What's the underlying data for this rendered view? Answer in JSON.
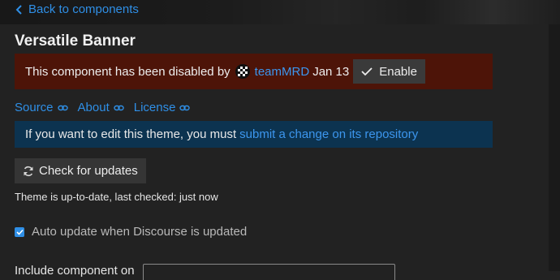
{
  "nav": {
    "back_label": "Back to components"
  },
  "page": {
    "title": "Versatile Banner"
  },
  "disabled_banner": {
    "message": "This component has been disabled by",
    "username": "teamMRD",
    "date": "Jan 13",
    "enable_label": "Enable",
    "color": "#4d1408"
  },
  "links": [
    {
      "label": "Source",
      "icon": "link-icon"
    },
    {
      "label": "About",
      "icon": "link-icon"
    },
    {
      "label": "License",
      "icon": "link-icon"
    }
  ],
  "info_banner": {
    "message": "If you want to edit this theme, you must",
    "link_label": "submit a change on its repository",
    "color": "#0c3350"
  },
  "updates": {
    "check_label": "Check for updates",
    "status": "Theme is up-to-date, last checked: just now",
    "auto_update_label": "Auto update when Discourse is updated",
    "auto_update_checked": true
  },
  "include": {
    "label": "Include component on"
  },
  "colors": {
    "accent": "#2f8fe6",
    "background": "#222222"
  }
}
